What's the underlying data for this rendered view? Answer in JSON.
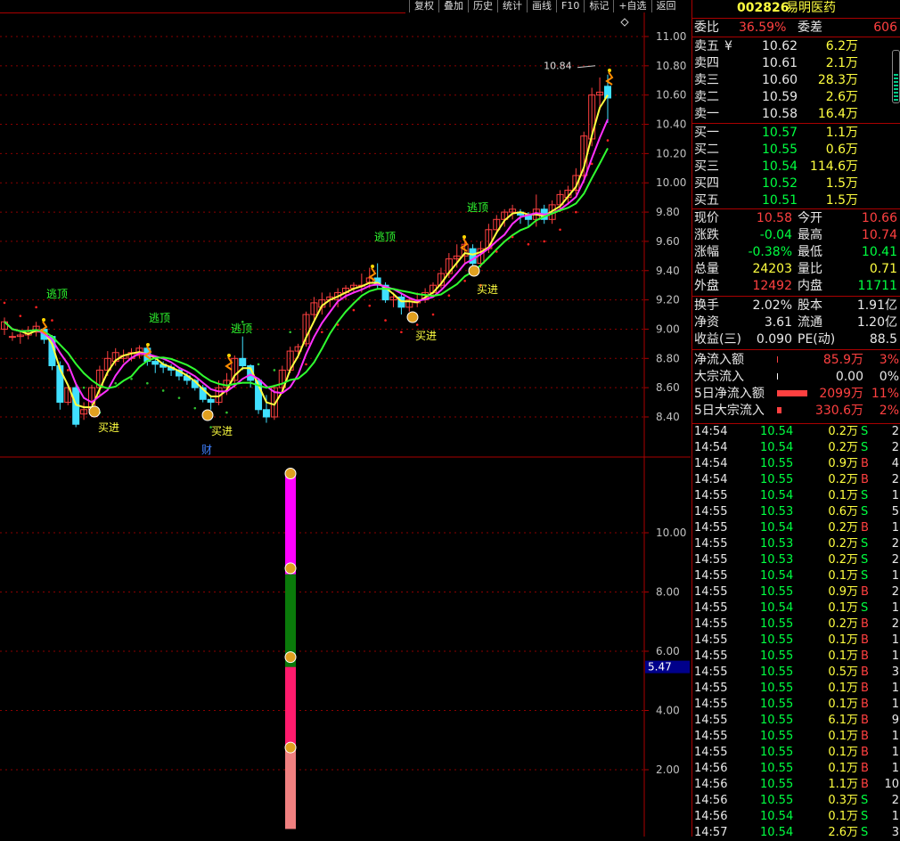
{
  "toolbar": {
    "items": [
      "复权",
      "叠加",
      "历史",
      "统计",
      "画线",
      "F10",
      "标记",
      "+自选",
      "返回"
    ]
  },
  "stock": {
    "code": "002826",
    "name": "易明医药"
  },
  "price_axis": {
    "ticks": [
      "11.00",
      "10.80",
      "10.60",
      "10.40",
      "10.20",
      "10.00",
      "9.80",
      "9.60",
      "9.40",
      "9.20",
      "9.00",
      "8.80",
      "8.60",
      "8.40"
    ]
  },
  "lower_axis": {
    "ticks": [
      "10.00",
      "8.00",
      "6.00",
      "4.00",
      "2.00"
    ],
    "current_label": "5.47"
  },
  "annotations": {
    "high_price": "10.84",
    "escape": "逃顶",
    "buy": "买进",
    "cai": "财"
  },
  "order_book": {
    "weibi_label": "委比",
    "weibi_value": "36.59%",
    "weicha_label": "委差",
    "weicha_value": "606",
    "sells": [
      {
        "label": "卖五",
        "price": "10.62",
        "vol": "6.2万"
      },
      {
        "label": "卖四",
        "price": "10.61",
        "vol": "2.1万"
      },
      {
        "label": "卖三",
        "price": "10.60",
        "vol": "28.3万"
      },
      {
        "label": "卖二",
        "price": "10.59",
        "vol": "2.6万"
      },
      {
        "label": "卖一",
        "price": "10.58",
        "vol": "16.4万"
      }
    ],
    "buys": [
      {
        "label": "买一",
        "price": "10.57",
        "vol": "1.1万"
      },
      {
        "label": "买二",
        "price": "10.55",
        "vol": "0.6万"
      },
      {
        "label": "买三",
        "price": "10.54",
        "vol": "114.6万"
      },
      {
        "label": "买四",
        "price": "10.52",
        "vol": "1.5万"
      },
      {
        "label": "买五",
        "price": "10.51",
        "vol": "1.5万"
      }
    ],
    "sell5_marker": "¥"
  },
  "stats": [
    {
      "l1": "现价",
      "v1": "10.58",
      "l2": "今开",
      "v2": "10.66"
    },
    {
      "l1": "涨跌",
      "v1": "-0.04",
      "l2": "最高",
      "v2": "10.74"
    },
    {
      "l1": "涨幅",
      "v1": "-0.38%",
      "l2": "最低",
      "v2": "10.41"
    },
    {
      "l1": "总量",
      "v1": "24203",
      "l2": "量比",
      "v2": "0.71"
    },
    {
      "l1": "外盘",
      "v1": "12492",
      "l2": "内盘",
      "v2": "11711"
    }
  ],
  "stats2": [
    {
      "l1": "换手",
      "v1": "2.02%",
      "l2": "股本",
      "v2": "1.91亿"
    },
    {
      "l1": "净资",
      "v1": "3.61",
      "l2": "流通",
      "v2": "1.20亿"
    },
    {
      "l1": "收益(三)",
      "v1": "0.090",
      "l2": "PE(动)",
      "v2": "88.5"
    }
  ],
  "flows": [
    {
      "label": "净流入额",
      "value": "85.9万",
      "pct": "3%"
    },
    {
      "label": "大宗流入",
      "value": "0.00",
      "pct": "0%"
    },
    {
      "label": "5日净流入额",
      "value": "2099万",
      "pct": "11%"
    },
    {
      "label": "5日大宗流入",
      "value": "330.6万",
      "pct": "2%"
    }
  ],
  "trades": [
    [
      "14:54",
      "10.54",
      "0.2万",
      "S",
      "2"
    ],
    [
      "14:54",
      "10.54",
      "0.2万",
      "S",
      "2"
    ],
    [
      "14:54",
      "10.55",
      "0.9万",
      "B",
      "4"
    ],
    [
      "14:54",
      "10.55",
      "0.2万",
      "B",
      "2"
    ],
    [
      "14:55",
      "10.54",
      "0.1万",
      "S",
      "1"
    ],
    [
      "14:55",
      "10.53",
      "0.6万",
      "S",
      "5"
    ],
    [
      "14:55",
      "10.54",
      "0.2万",
      "B",
      "1"
    ],
    [
      "14:55",
      "10.53",
      "0.2万",
      "S",
      "2"
    ],
    [
      "14:55",
      "10.53",
      "0.2万",
      "S",
      "2"
    ],
    [
      "14:55",
      "10.54",
      "0.1万",
      "S",
      "1"
    ],
    [
      "14:55",
      "10.55",
      "0.9万",
      "B",
      "2"
    ],
    [
      "14:55",
      "10.54",
      "0.1万",
      "S",
      "1"
    ],
    [
      "14:55",
      "10.55",
      "0.2万",
      "B",
      "2"
    ],
    [
      "14:55",
      "10.55",
      "0.1万",
      "B",
      "1"
    ],
    [
      "14:55",
      "10.55",
      "0.1万",
      "B",
      "1"
    ],
    [
      "14:55",
      "10.55",
      "0.5万",
      "B",
      "3"
    ],
    [
      "14:55",
      "10.55",
      "0.1万",
      "B",
      "1"
    ],
    [
      "14:55",
      "10.55",
      "0.1万",
      "B",
      "1"
    ],
    [
      "14:55",
      "10.55",
      "6.1万",
      "B",
      "9"
    ],
    [
      "14:55",
      "10.55",
      "0.1万",
      "B",
      "1"
    ],
    [
      "14:55",
      "10.55",
      "0.1万",
      "B",
      "1"
    ],
    [
      "14:56",
      "10.55",
      "0.1万",
      "B",
      "1"
    ],
    [
      "14:56",
      "10.55",
      "1.1万",
      "B",
      "10"
    ],
    [
      "14:56",
      "10.55",
      "0.3万",
      "S",
      "2"
    ],
    [
      "14:56",
      "10.54",
      "0.1万",
      "S",
      "1"
    ],
    [
      "14:57",
      "10.54",
      "2.6万",
      "S",
      "3"
    ]
  ],
  "colors": {
    "up": "#ff4040",
    "down": "#40e0ff",
    "ma1": "#ffff40",
    "ma2": "#ff30ff",
    "ma3": "#30ff30",
    "sar": "#ff2020",
    "bg": "#000000",
    "grid": "#8b0000"
  },
  "bars": [
    {
      "from": 5.47,
      "to": 12.0,
      "color": "#ff00ff"
    },
    {
      "from": 2.75,
      "to": 5.47,
      "color": "#ff1b6d"
    },
    {
      "from": 0,
      "to": 2.75,
      "color": "#f08080"
    },
    {
      "from": 5.47,
      "to": 8.6,
      "color": "#0a7a0a"
    }
  ]
}
